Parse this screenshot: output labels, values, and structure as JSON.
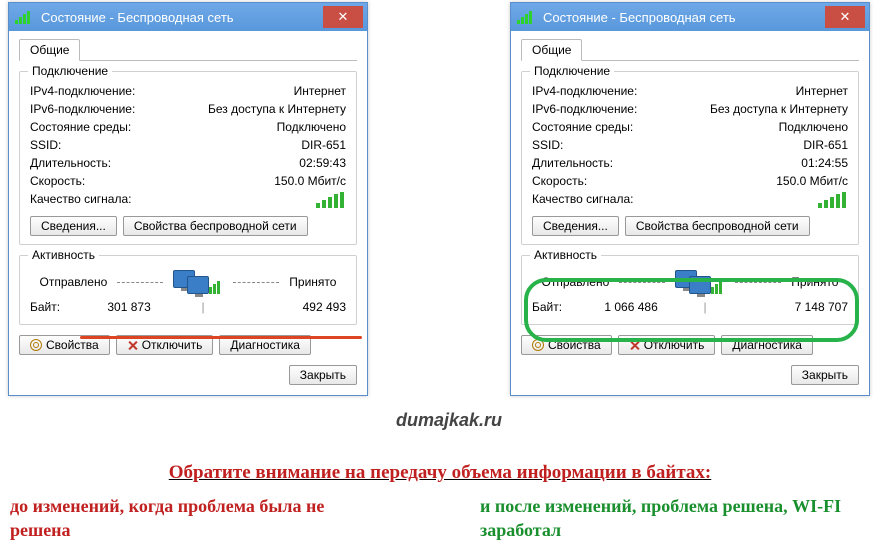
{
  "windows": [
    {
      "title": "Состояние - Беспроводная сеть",
      "tab": "Общие",
      "groups": {
        "connection": {
          "title": "Подключение",
          "ipv4_lbl": "IPv4-подключение:",
          "ipv4_val": "Интернет",
          "ipv6_lbl": "IPv6-подключение:",
          "ipv6_val": "Без доступа к Интернету",
          "media_lbl": "Состояние среды:",
          "media_val": "Подключено",
          "ssid_lbl": "SSID:",
          "ssid_val": "DIR-651",
          "dur_lbl": "Длительность:",
          "dur_val": "02:59:43",
          "speed_lbl": "Скорость:",
          "speed_val": "150.0 Мбит/с",
          "quality_lbl": "Качество сигнала:"
        },
        "activity": {
          "title": "Активность",
          "sent_lbl": "Отправлено",
          "recv_lbl": "Принято",
          "bytes_lbl": "Байт:",
          "sent_val": "301 873",
          "recv_val": "492 493"
        }
      },
      "buttons": {
        "details": "Сведения...",
        "wifi_props": "Свойства беспроводной сети",
        "props": "Свойства",
        "disconnect": "Отключить",
        "diag": "Диагностика",
        "close": "Закрыть"
      }
    },
    {
      "title": "Состояние - Беспроводная сеть",
      "tab": "Общие",
      "groups": {
        "connection": {
          "title": "Подключение",
          "ipv4_lbl": "IPv4-подключение:",
          "ipv4_val": "Интернет",
          "ipv6_lbl": "IPv6-подключение:",
          "ipv6_val": "Без доступа к Интернету",
          "media_lbl": "Состояние среды:",
          "media_val": "Подключено",
          "ssid_lbl": "SSID:",
          "ssid_val": "DIR-651",
          "dur_lbl": "Длительность:",
          "dur_val": "01:24:55",
          "speed_lbl": "Скорость:",
          "speed_val": "150.0 Мбит/с",
          "quality_lbl": "Качество сигнала:"
        },
        "activity": {
          "title": "Активность",
          "sent_lbl": "Отправлено",
          "recv_lbl": "Принято",
          "bytes_lbl": "Байт:",
          "sent_val": "1 066 486",
          "recv_val": "7 148 707"
        }
      },
      "buttons": {
        "details": "Сведения...",
        "wifi_props": "Свойства беспроводной сети",
        "props": "Свойства",
        "disconnect": "Отключить",
        "diag": "Диагностика",
        "close": "Закрыть"
      }
    }
  ],
  "watermark": "dumajkak.ru",
  "headline": "Обратите внимание на передачу объема информации в байтах:",
  "sub_left": "до изменений, когда проблема была не решена",
  "sub_right": "и после изменений, проблема решена, WI-FI заработал"
}
